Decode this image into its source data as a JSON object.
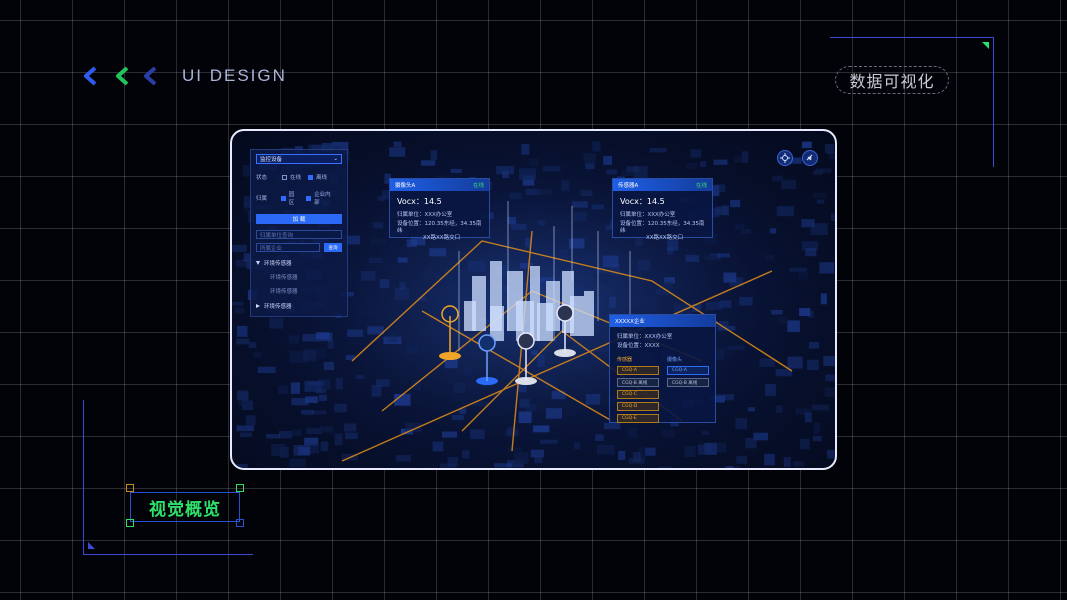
{
  "colors": {
    "accent_blue": "#2a6af7",
    "green": "#2ee06a",
    "orange": "#f0a52a",
    "frame": "#3a49d6"
  },
  "brand": {
    "text": "UI  DESIGN",
    "icons": [
      "chevron-left-blue",
      "chevron-left-green",
      "chevron-left-navy"
    ]
  },
  "tag_pill": "数据可视化",
  "overview_label": "视觉概览",
  "dashboard": {
    "filter": {
      "select_value": "监控设备",
      "status_label": "状态",
      "status_options": [
        "在线",
        "离线"
      ],
      "status_checked": [
        false,
        true
      ],
      "area_label": "归属",
      "area_options": [
        "园区",
        "企业内部"
      ],
      "area_checked": [
        true,
        true
      ],
      "load_button": "加 载",
      "search1_placeholder": "归属单位查询",
      "search2_placeholder": "所属企业",
      "query_button": "查询",
      "tree": [
        {
          "label": "环境传感器",
          "expanded": true,
          "children": [
            "环境传感器",
            "环境传感器"
          ]
        },
        {
          "label": "环境传感器",
          "expanded": false,
          "children": []
        }
      ]
    },
    "top_icons": [
      "crosshair-icon",
      "satellite-icon"
    ],
    "camera_card": {
      "title": "摄像头A",
      "status": "在线",
      "metric": "Vocx：14.5",
      "unit_label": "归属单位：XXX办公室",
      "location_label": "设备位置：120.35东经，34.35南纬",
      "location_line2": "XX路XX路交口"
    },
    "sensor_card": {
      "title": "传感器A",
      "status": "在线",
      "metric": "Vocx：14.5",
      "unit_label": "归属单位：XXX办公室",
      "location_label": "设备位置：120.35东经，34.35南纬",
      "location_line2": "XX路XX路交口"
    },
    "enterprise_card": {
      "title": "XXXXX企业",
      "unit_label": "归属单位：XXX办公室",
      "location_label": "设备位置：XXXX",
      "sensor_header": "传感器",
      "camera_header": "摄像头",
      "sensors": [
        "CGQ-A",
        "CGQ-B  离线",
        "CGQ-C",
        "CGQ-D",
        "CGQ-E"
      ],
      "cameras": [
        "CGQ-A",
        "CGQ-B  离线"
      ]
    }
  }
}
